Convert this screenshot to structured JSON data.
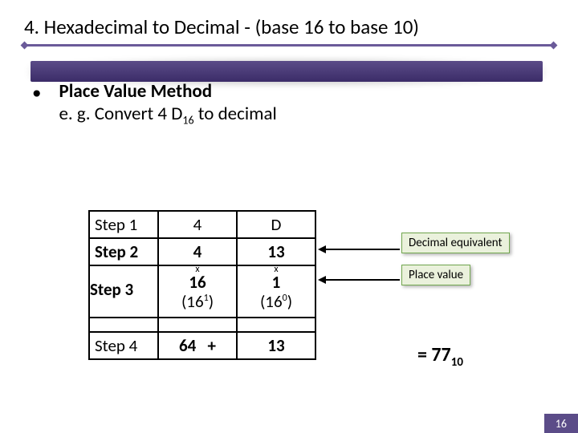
{
  "title": "4. Hexadecimal to Decimal - (base 16 to base 10)",
  "bullet": {
    "marker": "•",
    "line1": "Place Value Method",
    "line2_pre": "e. g. Convert 4 D",
    "line2_sub": "16",
    "line2_post": " to decimal"
  },
  "table": {
    "r1": {
      "step": "Step 1",
      "c1": "4",
      "c2": "D"
    },
    "r2": {
      "step": "Step 2",
      "c1": "4",
      "c2": "13"
    },
    "r3": {
      "step": "Step 3",
      "x": "x",
      "c1_main": "16",
      "c1_pow_base": "(16",
      "c1_pow_exp": "1",
      "c1_pow_close": ")",
      "c2_main": "1",
      "c2_pow_base": "(16",
      "c2_pow_exp": "0",
      "c2_pow_close": ")"
    },
    "r4": {
      "step": "Step 4",
      "c1": "64   +",
      "c2": "13"
    }
  },
  "annotations": {
    "decimal_equiv": "Decimal equivalent",
    "place_value": "Place value"
  },
  "result": {
    "pre": "= 77",
    "sub": "10"
  },
  "page_number": "16"
}
